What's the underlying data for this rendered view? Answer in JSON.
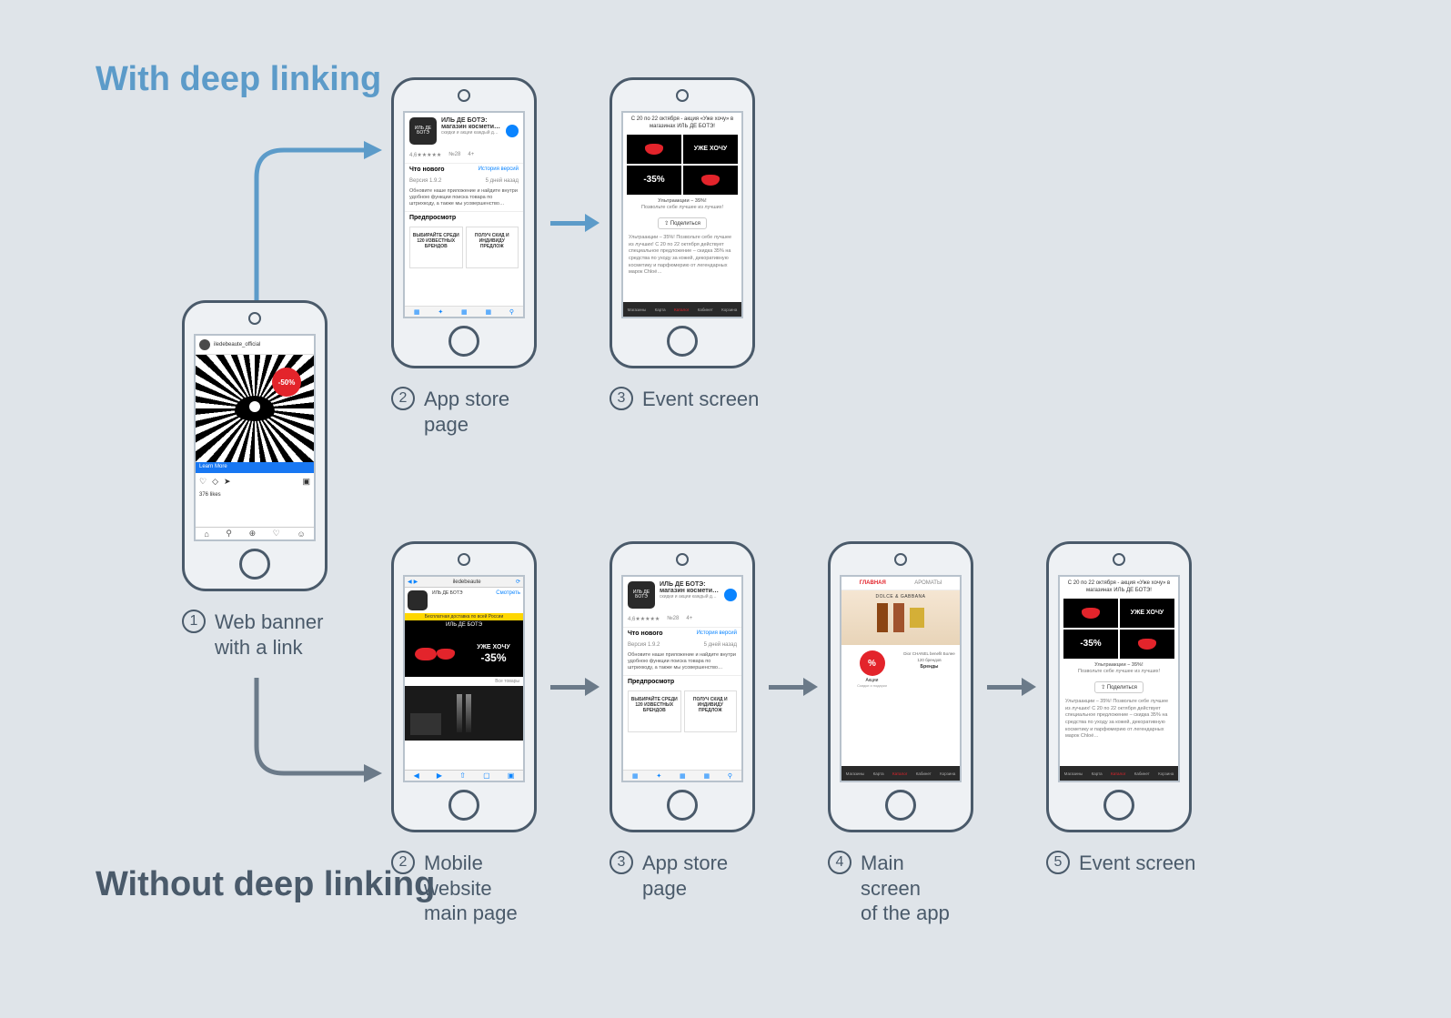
{
  "titles": {
    "with": "With deep linking",
    "without": "Without deep linking"
  },
  "steps": {
    "s1": {
      "n": "1",
      "label": "Web banner with a link"
    },
    "top2": {
      "n": "2",
      "label": "App store page"
    },
    "top3": {
      "n": "3",
      "label": "Event screen"
    },
    "bot2": {
      "n": "2",
      "label": "Mobile website main page"
    },
    "bot3": {
      "n": "3",
      "label": "App store page"
    },
    "bot4": {
      "n": "4",
      "label": "Main screen of the app"
    },
    "bot5": {
      "n": "5",
      "label": "Event screen"
    }
  },
  "colors": {
    "blue": "#5c9bc9",
    "gray": "#4a5a6a",
    "arrow_gray": "#6b7a89",
    "bg": "#dfe4e9",
    "red": "#e3242b"
  },
  "instagram": {
    "account": "iledebeaute_official",
    "discount": "-50%",
    "cta": "Learn More",
    "likes": "376 likes",
    "icons": [
      "♡",
      "💬",
      "➤",
      "🔖"
    ],
    "tabs": [
      "⌂",
      "🔍",
      "⊕",
      "♡",
      "☺"
    ]
  },
  "appstore": {
    "brand": "ИЛЬ ДЕ БОТЭ",
    "title": "ИЛЬ ДЕ БОТЭ: магазин космети…",
    "subtitle": "скидки и акции каждый д…",
    "rating": "4,6★★★★★",
    "rank": "№28",
    "age": "4+",
    "whats_new": "Что нового",
    "history": "История версий",
    "version": "Версия 1.9.2",
    "date": "5 дней назад",
    "body": "Обновите наше приложение и найдите внутри удобною функции поиска товара по штрихкоду, а также мы усовершенство…",
    "preview": "Предпросмотр",
    "card1": "ВЫБИРАЙТЕ СРЕДИ 120 ИЗВЕСТНЫХ БРЕНДОВ",
    "card2": "ПОЛУЧ СКИД И ИНДИВИДУ ПРЕДЛОЖ",
    "tabs": [
      "▢",
      "▢",
      "▢",
      "▢",
      "🔍"
    ]
  },
  "event": {
    "top": "С 20 по 22 октября - акция «Уже хочу» в магазинах ИЛЬ ДЕ БОТЭ!",
    "uhe": "УЖЕ ХОЧУ",
    "disc": "-35%",
    "promo_title": "Ультраакции – 35%!",
    "promo_sub": "Позвольте себе лучшее из лучших!",
    "share": "⇪ Поделиться",
    "body": "Ультраакции – 35%! Позвольте себе лучшее из лучших! С 20 по 22 октября действует специальное предложение – скидка 35% на средства по уходу за кожей, декоративную косметику и парфюмерию от легендарных марок Chloé…",
    "tabs": [
      "Магазины",
      "Карта",
      "Каталог",
      "Кабинет",
      "Корзина"
    ]
  },
  "mobileweb": {
    "view": "Смотреть",
    "yellow": "Бесплатная доставка по всей России",
    "brand": "ИЛЬ ДЕ БОТЭ",
    "uhe": "УЖЕ ХОЧУ",
    "disc": "-35%",
    "all": "Все товары",
    "tabs": [
      "◀",
      "▶",
      "⇧",
      "▢",
      "▢"
    ]
  },
  "mainapp": {
    "nav": [
      "ГЛАВНАЯ",
      "АРОМАТЫ"
    ],
    "pct": "%",
    "promo_l": "Акции",
    "promo_l2": "Скидки и подарки",
    "brands": "Dior CHANEL benefit Более 120 брендов",
    "brand_title": "Бренды"
  }
}
